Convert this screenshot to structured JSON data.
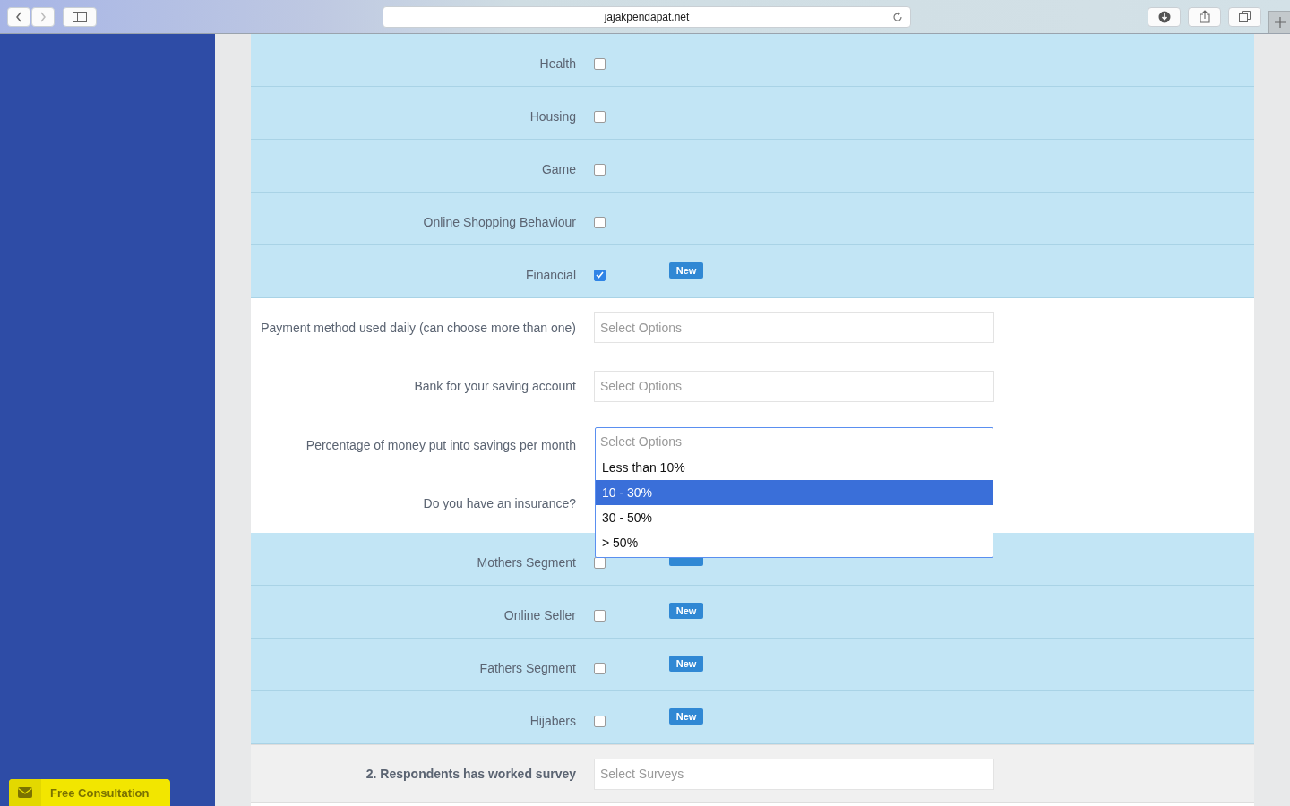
{
  "browser": {
    "url": "jajakpendapat.net"
  },
  "rows": [
    {
      "kind": "category",
      "label": "Health",
      "checked": false,
      "badge": false
    },
    {
      "kind": "category",
      "label": "Housing",
      "checked": false,
      "badge": false
    },
    {
      "kind": "category",
      "label": "Game",
      "checked": false,
      "badge": false
    },
    {
      "kind": "category",
      "label": "Online Shopping Behaviour",
      "checked": false,
      "badge": false
    },
    {
      "kind": "category",
      "label": "Financial",
      "checked": true,
      "badge": true,
      "badge_label": "New"
    },
    {
      "kind": "question",
      "label": "Payment method used daily (can choose more than one)",
      "placeholder": "Select Options",
      "expanded": false
    },
    {
      "kind": "question",
      "label": "Bank for your saving account",
      "placeholder": "Select Options",
      "expanded": false
    },
    {
      "kind": "question",
      "label": "Percentage of money put into savings per month",
      "placeholder": "Select Options",
      "expanded": true,
      "options": [
        {
          "label": "Less than 10%",
          "selected": false
        },
        {
          "label": "10 - 30%",
          "selected": true
        },
        {
          "label": "30 - 50%",
          "selected": false
        },
        {
          "label": "> 50%",
          "selected": false
        }
      ]
    },
    {
      "kind": "question",
      "label": "Do you have an insurance?",
      "expanded": false
    },
    {
      "kind": "category",
      "label": "Mothers Segment",
      "checked": false,
      "badge": true
    },
    {
      "kind": "category",
      "label": "Online Seller",
      "checked": false,
      "badge": true,
      "badge_label": "New"
    },
    {
      "kind": "category",
      "label": "Fathers Segment",
      "checked": false,
      "badge": true,
      "badge_label": "New"
    },
    {
      "kind": "category",
      "label": "Hijabers",
      "checked": false,
      "badge": true,
      "badge_label": "New"
    }
  ],
  "survey_filter": {
    "label": "2. Respondents has worked survey",
    "placeholder": "Select Surveys"
  },
  "consultation_button": {
    "label": "Free Consultation"
  }
}
